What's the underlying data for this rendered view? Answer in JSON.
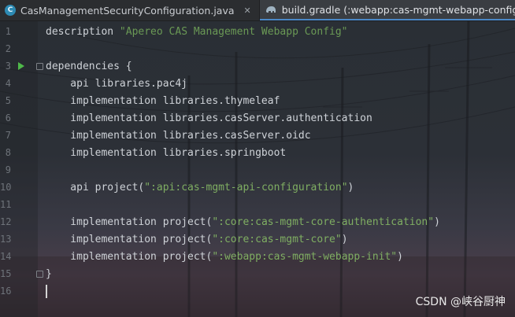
{
  "tabs": [
    {
      "label": "CasManagementSecurityConfiguration.java",
      "icon": "java-class-icon",
      "active": false
    },
    {
      "label": "build.gradle (:webapp:cas-mgmt-webapp-config)",
      "icon": "gradle-elephant-icon",
      "active": true
    },
    {
      "label": "",
      "icon": "gradle-elephant-icon",
      "active": false
    }
  ],
  "editor": {
    "line_numbers": [
      "1",
      "2",
      "3",
      "4",
      "5",
      "6",
      "7",
      "8",
      "9",
      "10",
      "11",
      "12",
      "13",
      "14",
      "15",
      "16"
    ],
    "lines": [
      {
        "n": "1",
        "plain": "description ",
        "str": "\"Apereo CAS Management Webapp Config\"",
        "tail": ""
      },
      {
        "n": "2",
        "plain": "",
        "str": "",
        "tail": ""
      },
      {
        "n": "3",
        "plain": "dependencies {",
        "str": "",
        "tail": ""
      },
      {
        "n": "4",
        "plain": "    api libraries.pac4j",
        "str": "",
        "tail": ""
      },
      {
        "n": "5",
        "plain": "    implementation libraries.thymeleaf",
        "str": "",
        "tail": ""
      },
      {
        "n": "6",
        "plain": "    implementation libraries.casServer.authentication",
        "str": "",
        "tail": ""
      },
      {
        "n": "7",
        "plain": "    implementation libraries.casServer.oidc",
        "str": "",
        "tail": ""
      },
      {
        "n": "8",
        "plain": "    implementation libraries.springboot",
        "str": "",
        "tail": ""
      },
      {
        "n": "9",
        "plain": "",
        "str": "",
        "tail": ""
      },
      {
        "n": "10",
        "plain": "    api project(",
        "str": "\":api:cas-mgmt-api-configuration\"",
        "tail": ")"
      },
      {
        "n": "11",
        "plain": "",
        "str": "",
        "tail": ""
      },
      {
        "n": "12",
        "plain": "    implementation project(",
        "str": "\":core:cas-mgmt-core-authentication\"",
        "tail": ")"
      },
      {
        "n": "13",
        "plain": "    implementation project(",
        "str": "\":core:cas-mgmt-core\"",
        "tail": ")"
      },
      {
        "n": "14",
        "plain": "    implementation project(",
        "str": "\":webapp:cas-mgmt-webapp-init\"",
        "tail": ")"
      },
      {
        "n": "15",
        "plain": "}",
        "str": "",
        "tail": ""
      },
      {
        "n": "16",
        "plain": "",
        "str": "",
        "tail": ""
      }
    ]
  },
  "watermark": "CSDN @峡谷厨神",
  "colors": {
    "string": "#6a9955",
    "code": "#cfd3d8",
    "line_number": "#6e737a",
    "run_icon": "#4fb84a",
    "active_tab_underline": "#4a88c7"
  }
}
